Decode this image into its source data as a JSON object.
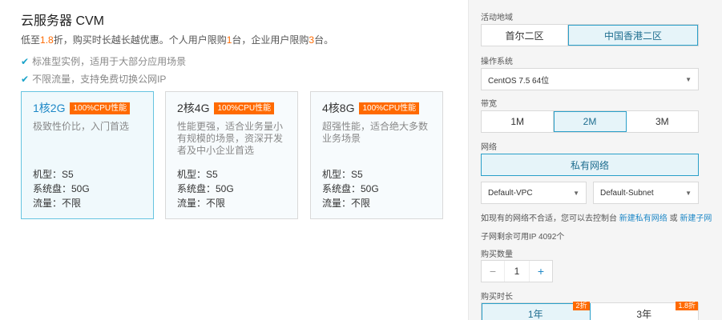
{
  "product": {
    "title": "云服务器 CVM",
    "promo_pre": "低至",
    "promo_rate": "1.8",
    "promo_mid": "折，购买时长越长越优惠。个人用户限购",
    "promo_personal": "1",
    "promo_mid2": "台，企业用户限购",
    "promo_enterprise": "3",
    "promo_end": "台。",
    "features": [
      "标准型实例，适用于大部分应用场景",
      "不限流量，支持免费切换公网IP"
    ]
  },
  "cards": [
    {
      "spec": "1核2G",
      "badge": "100%CPU性能",
      "desc": "极致性价比，入门首选",
      "model": "机型：S5",
      "disk": "系统盘：50G",
      "traffic": "流量：不限"
    },
    {
      "spec": "2核4G",
      "badge": "100%CPU性能",
      "desc": "性能更强，适合业务量小有规模的场景，资深开发者及中小企业首选",
      "model": "机型：S5",
      "disk": "系统盘：50G",
      "traffic": "流量：不限"
    },
    {
      "spec": "4核8G",
      "badge": "100%CPU性能",
      "desc": "超强性能，适合绝大多数业务场景",
      "model": "机型：S5",
      "disk": "系统盘：50G",
      "traffic": "流量：不限"
    }
  ],
  "config": {
    "region_label": "活动地域",
    "regions": [
      "首尔二区",
      "中国香港二区"
    ],
    "os_label": "操作系统",
    "os_value": "CentOS 7.5 64位",
    "bandwidth_label": "带宽",
    "bandwidths": [
      "1M",
      "2M",
      "3M"
    ],
    "network_label": "网络",
    "network_value": "私有网络",
    "vpc_value": "Default-VPC",
    "subnet_value": "Default-Subnet",
    "hint_pre": "如现有的网络不合适，您可以去控制台",
    "hint_link1": "新建私有网络",
    "hint_or": "或",
    "hint_link2": "新建子网",
    "subnet_ip": "子网剩余可用IP 4092个",
    "quantity_label": "购买数量",
    "quantity_value": "1",
    "minus": "−",
    "plus": "+",
    "duration_label": "购买时长",
    "durations": [
      {
        "label": "1年",
        "discount": "2折"
      },
      {
        "label": "3年",
        "discount": "1.8折"
      }
    ]
  },
  "colors": {
    "accent": "#2a9fc9",
    "badge": "#ff6a00"
  }
}
